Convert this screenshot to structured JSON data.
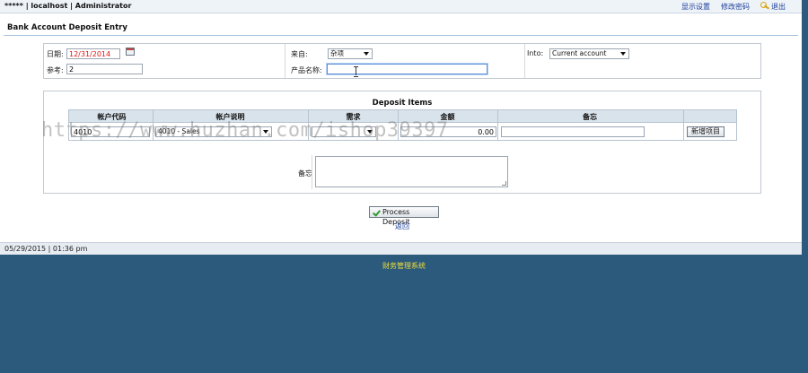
{
  "topbar": {
    "identity": "***** | localhost | Administrator",
    "links": [
      "显示设置",
      "修改密码",
      "退出"
    ]
  },
  "page_title": "Bank Account Deposit Entry",
  "header_form": {
    "date_label": "日期:",
    "date_value": "12/31/2014",
    "ref_label": "参考:",
    "ref_value": "2",
    "from_label": "来自:",
    "from_value": "杂项",
    "product_label": "产品名称:",
    "product_value": "",
    "into_label": "Into:",
    "into_value": "Current account"
  },
  "items": {
    "title": "Deposit Items",
    "columns": [
      "帐户代码",
      "帐户说明",
      "需求",
      "金额",
      "备忘"
    ],
    "row": {
      "account_code": "4010",
      "account_desc": "4010 - Sales",
      "demand": "",
      "amount": "0.00",
      "memo": ""
    },
    "add_button": "新增项目",
    "memo_label": "备忘"
  },
  "actions": {
    "process_label": "Process Deposit",
    "back_label": "返回"
  },
  "status": {
    "datetime": "05/29/2015 | 01:36 pm"
  },
  "footer": "财务管理系统",
  "watermark": "https://www.huzhan.com/ishop39397",
  "colors": {
    "page_background": "#2b5a7d",
    "link": "#1d3f9a",
    "footer_text": "#f1df3a",
    "date_text": "#dd1111"
  }
}
